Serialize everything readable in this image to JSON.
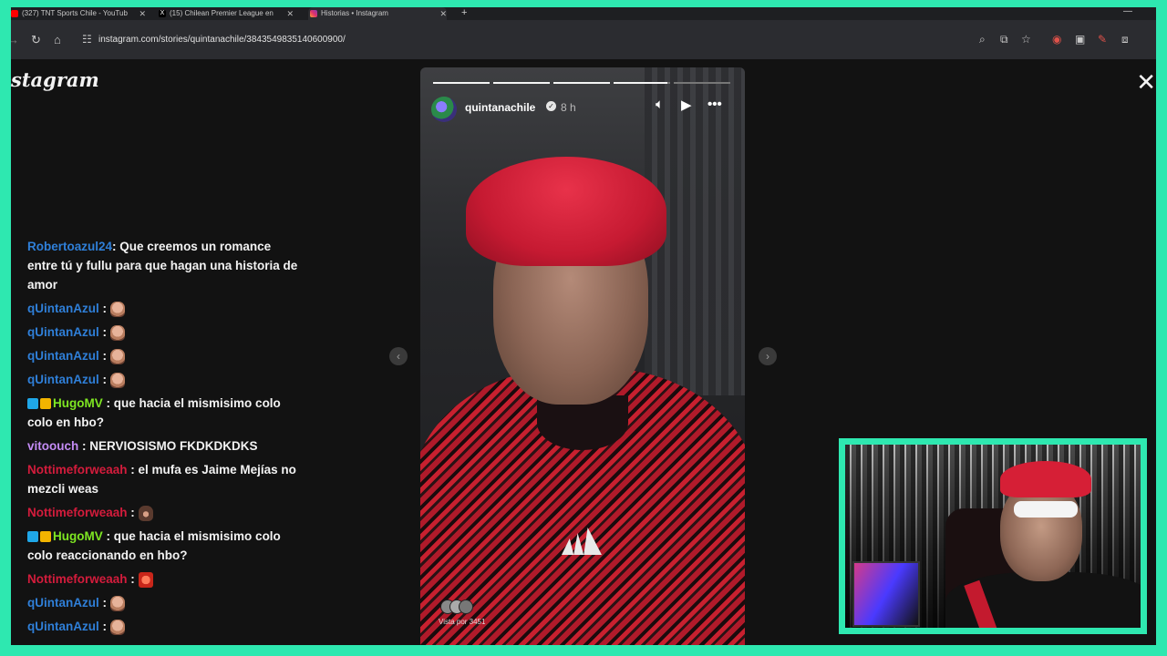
{
  "browser": {
    "tabs": [
      {
        "title": "(327) TNT Sports Chile - YouTub",
        "active": false,
        "icon": "youtube-icon"
      },
      {
        "title": "(15) Chilean Premier League en",
        "active": false,
        "icon": "x-icon"
      },
      {
        "title": "Historias • Instagram",
        "active": true,
        "icon": "instagram-icon"
      }
    ],
    "url": "instagram.com/stories/quintanachile/3843549835140600900/"
  },
  "instagram": {
    "logo": "stagram"
  },
  "chat": {
    "messages": [
      {
        "user": "Robertoazul24",
        "color": "#2f7fd8",
        "text": ": Que creemos un romance entre tú y fullu para que hagan una historia de amor",
        "emote": false,
        "badges": false
      },
      {
        "user": "qUintanAzul",
        "color": "#2f7fd8",
        "text": " :",
        "emote": "face",
        "badges": false
      },
      {
        "user": "qUintanAzul",
        "color": "#2f7fd8",
        "text": " :",
        "emote": "face",
        "badges": false
      },
      {
        "user": "qUintanAzul",
        "color": "#2f7fd8",
        "text": " :",
        "emote": "face",
        "badges": false
      },
      {
        "user": "qUintanAzul",
        "color": "#2f7fd8",
        "text": " :",
        "emote": "face",
        "badges": false
      },
      {
        "user": "HugoMV",
        "color": "#7ee622",
        "text": " : que hacia el mismisimo colo colo en hbo?",
        "emote": false,
        "badges": true
      },
      {
        "user": "vitoouch",
        "color": "#c48cf5",
        "text": " : NERVIOSISMO FKDKDKDKS",
        "emote": false,
        "badges": false
      },
      {
        "user": "Nottimeforweaah",
        "color": "#d41c3c",
        "text": " : el mufa es Jaime Mejías no mezcli weas",
        "emote": false,
        "badges": false
      },
      {
        "user": "Nottimeforweaah",
        "color": "#d41c3c",
        "text": " :",
        "emote": "dark",
        "badges": false
      },
      {
        "user": "HugoMV",
        "color": "#7ee622",
        "text": " : que hacia el mismisimo colo colo reaccionando en hbo?",
        "emote": false,
        "badges": true
      },
      {
        "user": "Nottimeforweaah",
        "color": "#d41c3c",
        "text": " :",
        "emote": "red",
        "badges": false
      },
      {
        "user": "qUintanAzul",
        "color": "#2f7fd8",
        "text": " :",
        "emote": "face",
        "badges": false
      },
      {
        "user": "qUintanAzul",
        "color": "#2f7fd8",
        "text": " :",
        "emote": "face",
        "badges": false
      }
    ]
  },
  "story": {
    "username": "quintanachile",
    "time": "8 h",
    "progress": [
      1,
      1,
      1,
      0.95,
      0
    ],
    "viewers": "Vista por 3451"
  },
  "colors": {
    "accent": "#2ee8b0",
    "page_bg": "#121212"
  }
}
